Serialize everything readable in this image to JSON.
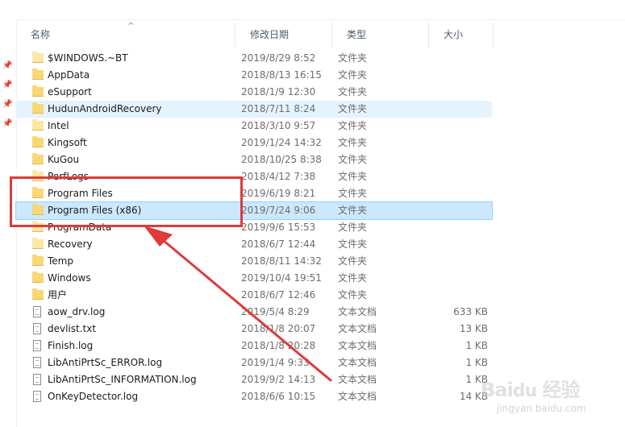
{
  "columns": {
    "name": "名称",
    "date": "修改日期",
    "type": "类型",
    "size": "大小"
  },
  "files": [
    {
      "name": "$WINDOWS.~BT",
      "date": "2019/8/29 8:52",
      "type": "文件夹",
      "size": "",
      "icon": "folder-icon"
    },
    {
      "name": "AppData",
      "date": "2018/8/13 16:15",
      "type": "文件夹",
      "size": "",
      "icon": "folder-icon"
    },
    {
      "name": "eSupport",
      "date": "2018/1/9 12:30",
      "type": "文件夹",
      "size": "",
      "icon": "folder-icon"
    },
    {
      "name": "HudunAndroidRecovery",
      "date": "2018/7/11 8:24",
      "type": "文件夹",
      "size": "",
      "icon": "folder-icon"
    },
    {
      "name": "Intel",
      "date": "2018/3/10 9:57",
      "type": "文件夹",
      "size": "",
      "icon": "folder-icon"
    },
    {
      "name": "Kingsoft",
      "date": "2019/1/24 14:32",
      "type": "文件夹",
      "size": "",
      "icon": "folder-icon"
    },
    {
      "name": "KuGou",
      "date": "2018/10/25 8:38",
      "type": "文件夹",
      "size": "",
      "icon": "folder-icon"
    },
    {
      "name": "PerfLogs",
      "date": "2018/4/12 7:38",
      "type": "文件夹",
      "size": "",
      "icon": "folder-icon"
    },
    {
      "name": "Program Files",
      "date": "2019/6/19 8:21",
      "type": "文件夹",
      "size": "",
      "icon": "folder-icon"
    },
    {
      "name": "Program Files (x86)",
      "date": "2019/7/24 9:06",
      "type": "文件夹",
      "size": "",
      "icon": "folder-icon"
    },
    {
      "name": "ProgramData",
      "date": "2019/9/6 15:53",
      "type": "文件夹",
      "size": "",
      "icon": "folder-icon"
    },
    {
      "name": "Recovery",
      "date": "2018/6/7 12:44",
      "type": "文件夹",
      "size": "",
      "icon": "folder-icon"
    },
    {
      "name": "Temp",
      "date": "2018/8/11 14:32",
      "type": "文件夹",
      "size": "",
      "icon": "folder-icon"
    },
    {
      "name": "Windows",
      "date": "2019/10/4 19:51",
      "type": "文件夹",
      "size": "",
      "icon": "folder-icon"
    },
    {
      "name": "用户",
      "date": "2018/6/7 12:46",
      "type": "文件夹",
      "size": "",
      "icon": "folder-icon"
    },
    {
      "name": "aow_drv.log",
      "date": "2019/5/4 8:29",
      "type": "文本文档",
      "size": "633 KB",
      "icon": "text-file-icon"
    },
    {
      "name": "devlist.txt",
      "date": "2018/1/8 20:07",
      "type": "文本文档",
      "size": "13 KB",
      "icon": "text-file-icon"
    },
    {
      "name": "Finish.log",
      "date": "2018/1/8 20:28",
      "type": "文本文档",
      "size": "1 KB",
      "icon": "text-file-icon"
    },
    {
      "name": "LibAntiPrtSc_ERROR.log",
      "date": "2019/1/4 9:33",
      "type": "文本文档",
      "size": "1 KB",
      "icon": "text-file-icon"
    },
    {
      "name": "LibAntiPrtSc_INFORMATION.log",
      "date": "2019/9/2 14:13",
      "type": "文本文档",
      "size": "1 KB",
      "icon": "text-file-icon"
    },
    {
      "name": "OnKeyDetector.log",
      "date": "2018/6/6 10:15",
      "type": "文本文档",
      "size": "14 KB",
      "icon": "text-file-icon"
    }
  ],
  "hovered_row": "HudunAndroidRecovery",
  "selected_row": "Program Files (x86)",
  "light_folders": [
    "$WINDOWS.~BT",
    "Intel",
    "PerfLogs",
    "ProgramData",
    "Recovery"
  ],
  "colors": {
    "annotation": "#e03a3a",
    "selection": "#cce8ff",
    "hover": "#e5f3ff",
    "folder": "#f8d775"
  },
  "watermark": {
    "url": "jingyan.baidu.com"
  }
}
